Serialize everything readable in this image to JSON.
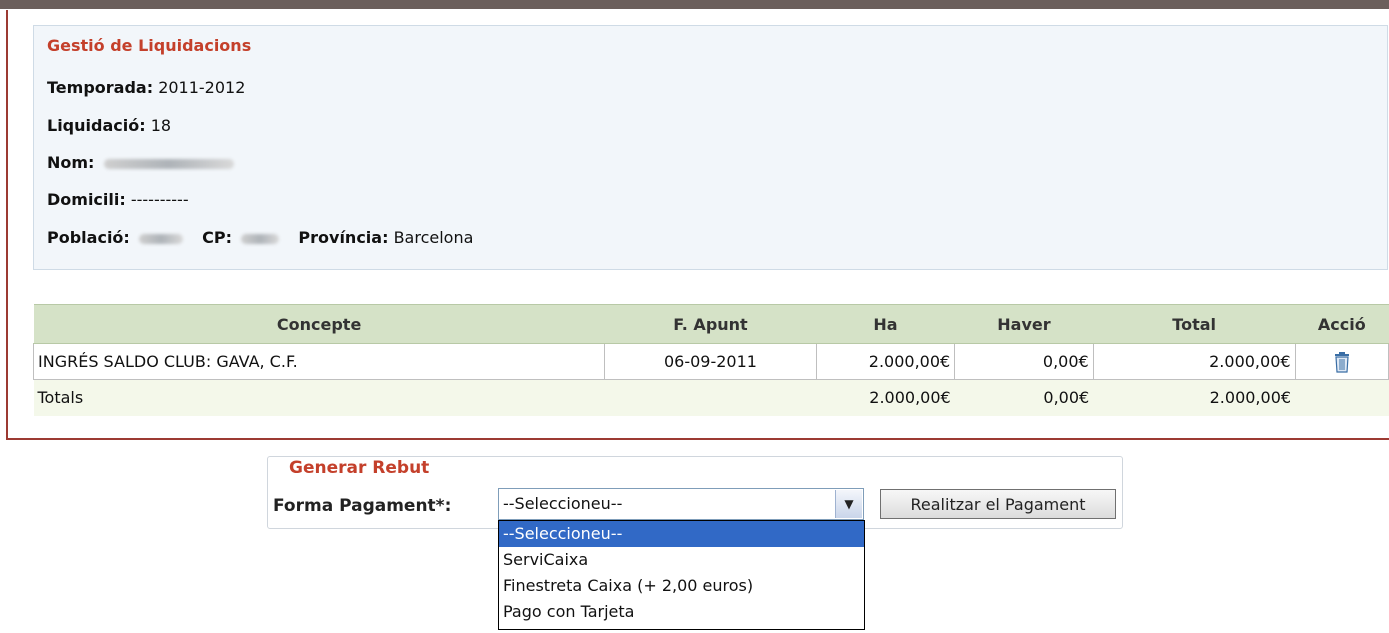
{
  "info": {
    "title": "Gestió de Liquidacions",
    "temporada_label": "Temporada:",
    "temporada_value": "2011-2012",
    "liquidacio_label": "Liquidació:",
    "liquidacio_value": "18",
    "nom_label": "Nom:",
    "domicili_label": "Domicili:",
    "domicili_value": "----------",
    "poblacio_label": "Població:",
    "cp_label": "CP:",
    "provincia_label": "Província:",
    "provincia_value": "Barcelona"
  },
  "table": {
    "headers": [
      "Concepte",
      "F. Apunt",
      "Ha",
      "Haver",
      "Total",
      "Acció"
    ],
    "rows": [
      {
        "concepte": "INGRÉS SALDO CLUB: GAVA, C.F.",
        "f_apunt": "06-09-2011",
        "ha": "2.000,00€",
        "haver": "0,00€",
        "total": "2.000,00€",
        "action_icon": "trash-icon"
      }
    ],
    "totals": {
      "label": "Totals",
      "ha": "2.000,00€",
      "haver": "0,00€",
      "total": "2.000,00€"
    }
  },
  "rebut": {
    "legend": "Generar Rebut",
    "forma_label": "Forma Pagament*:",
    "selected": "--Seleccioneu--",
    "options": [
      "--Seleccioneu--",
      "ServiCaixa",
      "Finestreta Caixa (+ 2,00 euros)",
      "Pago con Tarjeta"
    ],
    "button_label": "Realitzar el Pagament"
  },
  "colors": {
    "accent_title": "#c4402b",
    "panel_border": "#9c3a32",
    "table_header_bg": "#d5e2c7",
    "selection": "#3169c6"
  }
}
